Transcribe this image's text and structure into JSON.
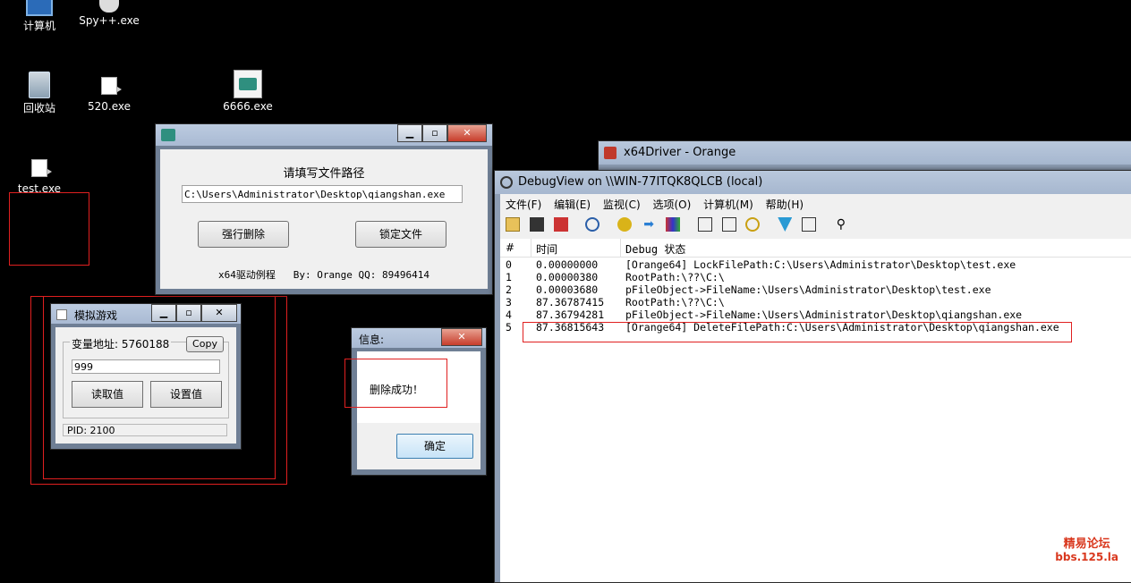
{
  "desktop": {
    "icons": [
      {
        "label": "计算机"
      },
      {
        "label": "Spy++.exe"
      },
      {
        "label": "回收站"
      },
      {
        "label": "520.exe"
      },
      {
        "label": "6666.exe"
      },
      {
        "label": "test.exe"
      }
    ]
  },
  "driver_window": {
    "heading": "请填写文件路径",
    "path_value": "C:\\Users\\Administrator\\Desktop\\qiangshan.exe",
    "force_delete_label": "强行删除",
    "lock_file_label": "锁定文件",
    "footer": "x64驱动例程   By: Orange QQ: 89496414"
  },
  "game_window": {
    "title": "模拟游戏",
    "var_label": "变量地址: 5760188",
    "copy_label": "Copy",
    "input_value": "999",
    "read_label": "读取值",
    "set_label": "设置值",
    "status": "PID: 2100"
  },
  "info_dialog": {
    "title": "信息:",
    "message": "删除成功！",
    "ok_label": "确定"
  },
  "x64driver_window": {
    "title": "x64Driver - Orange"
  },
  "debugview": {
    "title": "DebugView on \\\\WIN-77ITQK8QLCB (local)",
    "menu": [
      "文件(F)",
      "编辑(E)",
      "监视(C)",
      "选项(O)",
      "计算机(M)",
      "帮助(H)"
    ],
    "columns": [
      "#",
      "时间",
      "Debug 状态"
    ],
    "rows": [
      {
        "n": "0",
        "time": "0.00000000",
        "msg": "[Orange64] LockFilePath:C:\\Users\\Administrator\\Desktop\\test.exe"
      },
      {
        "n": "1",
        "time": "0.00000380",
        "msg": "RootPath:\\??\\C:\\"
      },
      {
        "n": "2",
        "time": "0.00003680",
        "msg": "pFileObject->FileName:\\Users\\Administrator\\Desktop\\test.exe"
      },
      {
        "n": "3",
        "time": "87.36787415",
        "msg": "RootPath:\\??\\C:\\"
      },
      {
        "n": "4",
        "time": "87.36794281",
        "msg": "pFileObject->FileName:\\Users\\Administrator\\Desktop\\qiangshan.exe"
      },
      {
        "n": "5",
        "time": "87.36815643",
        "msg": "[Orange64] DeleteFilePath:C:\\Users\\Administrator\\Desktop\\qiangshan.exe"
      }
    ]
  },
  "watermark": {
    "line1": "精易论坛",
    "line2": "bbs.125.la",
    "color": "#d9381e"
  }
}
